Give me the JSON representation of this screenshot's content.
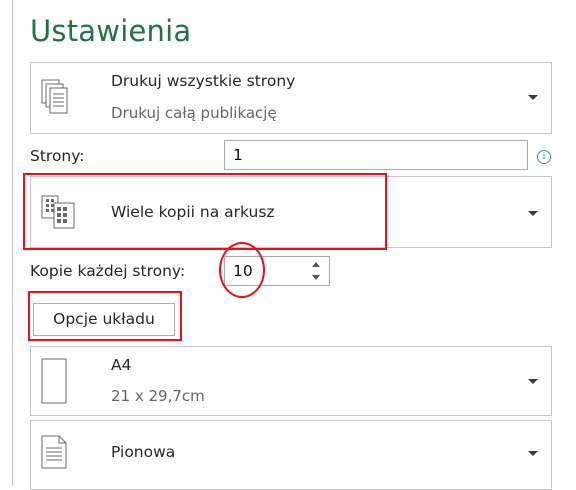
{
  "settings": {
    "title": "Ustawienia",
    "print_range": {
      "label": "Drukuj wszystkie strony",
      "sublabel": "Drukuj całą publikację",
      "icon": "pages-stack-icon"
    },
    "pages": {
      "label": "Strony:",
      "value": "1",
      "info_icon": "info-icon"
    },
    "multiple": {
      "label": "Wiele kopii na arkusz",
      "icon": "multiple-copies-icon"
    },
    "copies": {
      "label": "Kopie każdej strony:",
      "value": "10"
    },
    "layout_button": {
      "label": "Opcje układu"
    },
    "paper": {
      "label": "A4",
      "sublabel": "21 x 29,7cm",
      "icon": "page-size-icon"
    },
    "orientation": {
      "label": "Pionowa",
      "icon": "portrait-icon"
    },
    "colors": {
      "accent": "#217346",
      "highlight": "#e8101a",
      "info": "#4a86c8"
    }
  }
}
